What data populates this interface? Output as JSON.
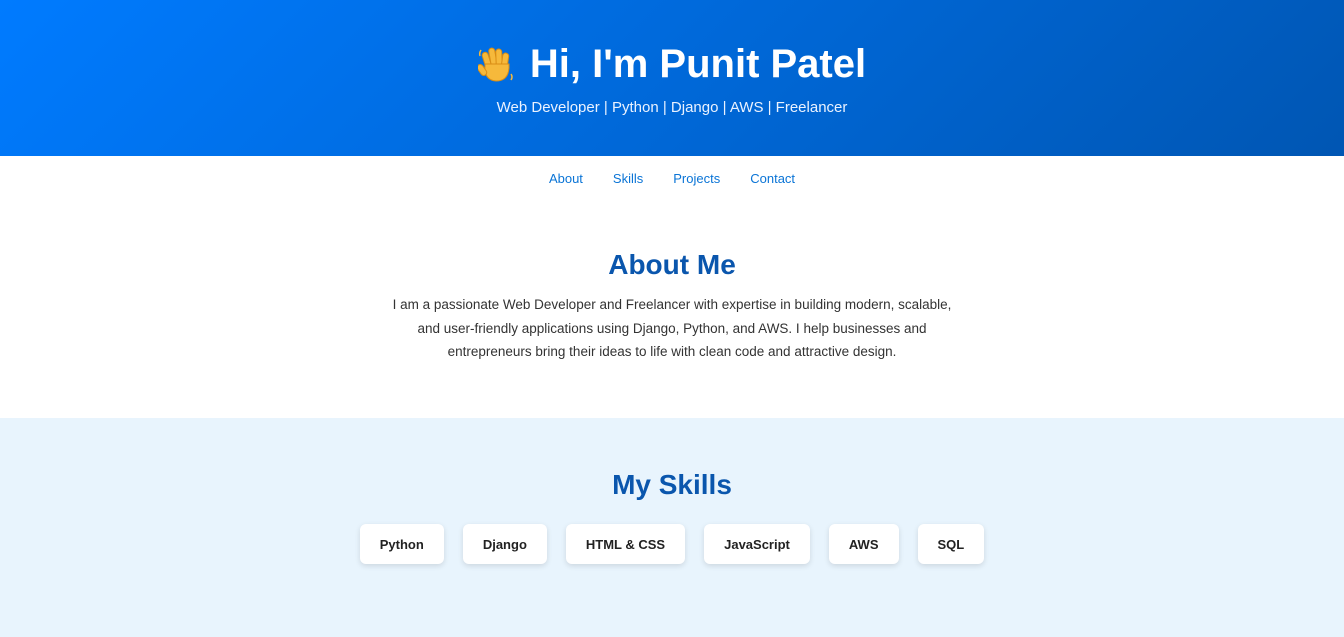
{
  "hero": {
    "emoji_icon": "waving-hand-icon",
    "title": "Hi, I'm Punit Patel",
    "subtitle": "Web Developer | Python | Django | AWS | Freelancer"
  },
  "nav": {
    "items": [
      "About",
      "Skills",
      "Projects",
      "Contact"
    ]
  },
  "about": {
    "title": "About Me",
    "text": "I am a passionate Web Developer and Freelancer with expertise in building modern, scalable, and user-friendly applications using Django, Python, and AWS. I help businesses and entrepreneurs bring their ideas to life with clean code and attractive design."
  },
  "skills": {
    "title": "My Skills",
    "items": [
      "Python",
      "Django",
      "HTML & CSS",
      "JavaScript",
      "AWS",
      "SQL"
    ]
  },
  "colors": {
    "hero_gradient_start": "#007bff",
    "hero_gradient_end": "#0056b3",
    "link": "#0a74d6",
    "heading": "#0a56ad",
    "skills_bg": "#e8f4fd"
  }
}
